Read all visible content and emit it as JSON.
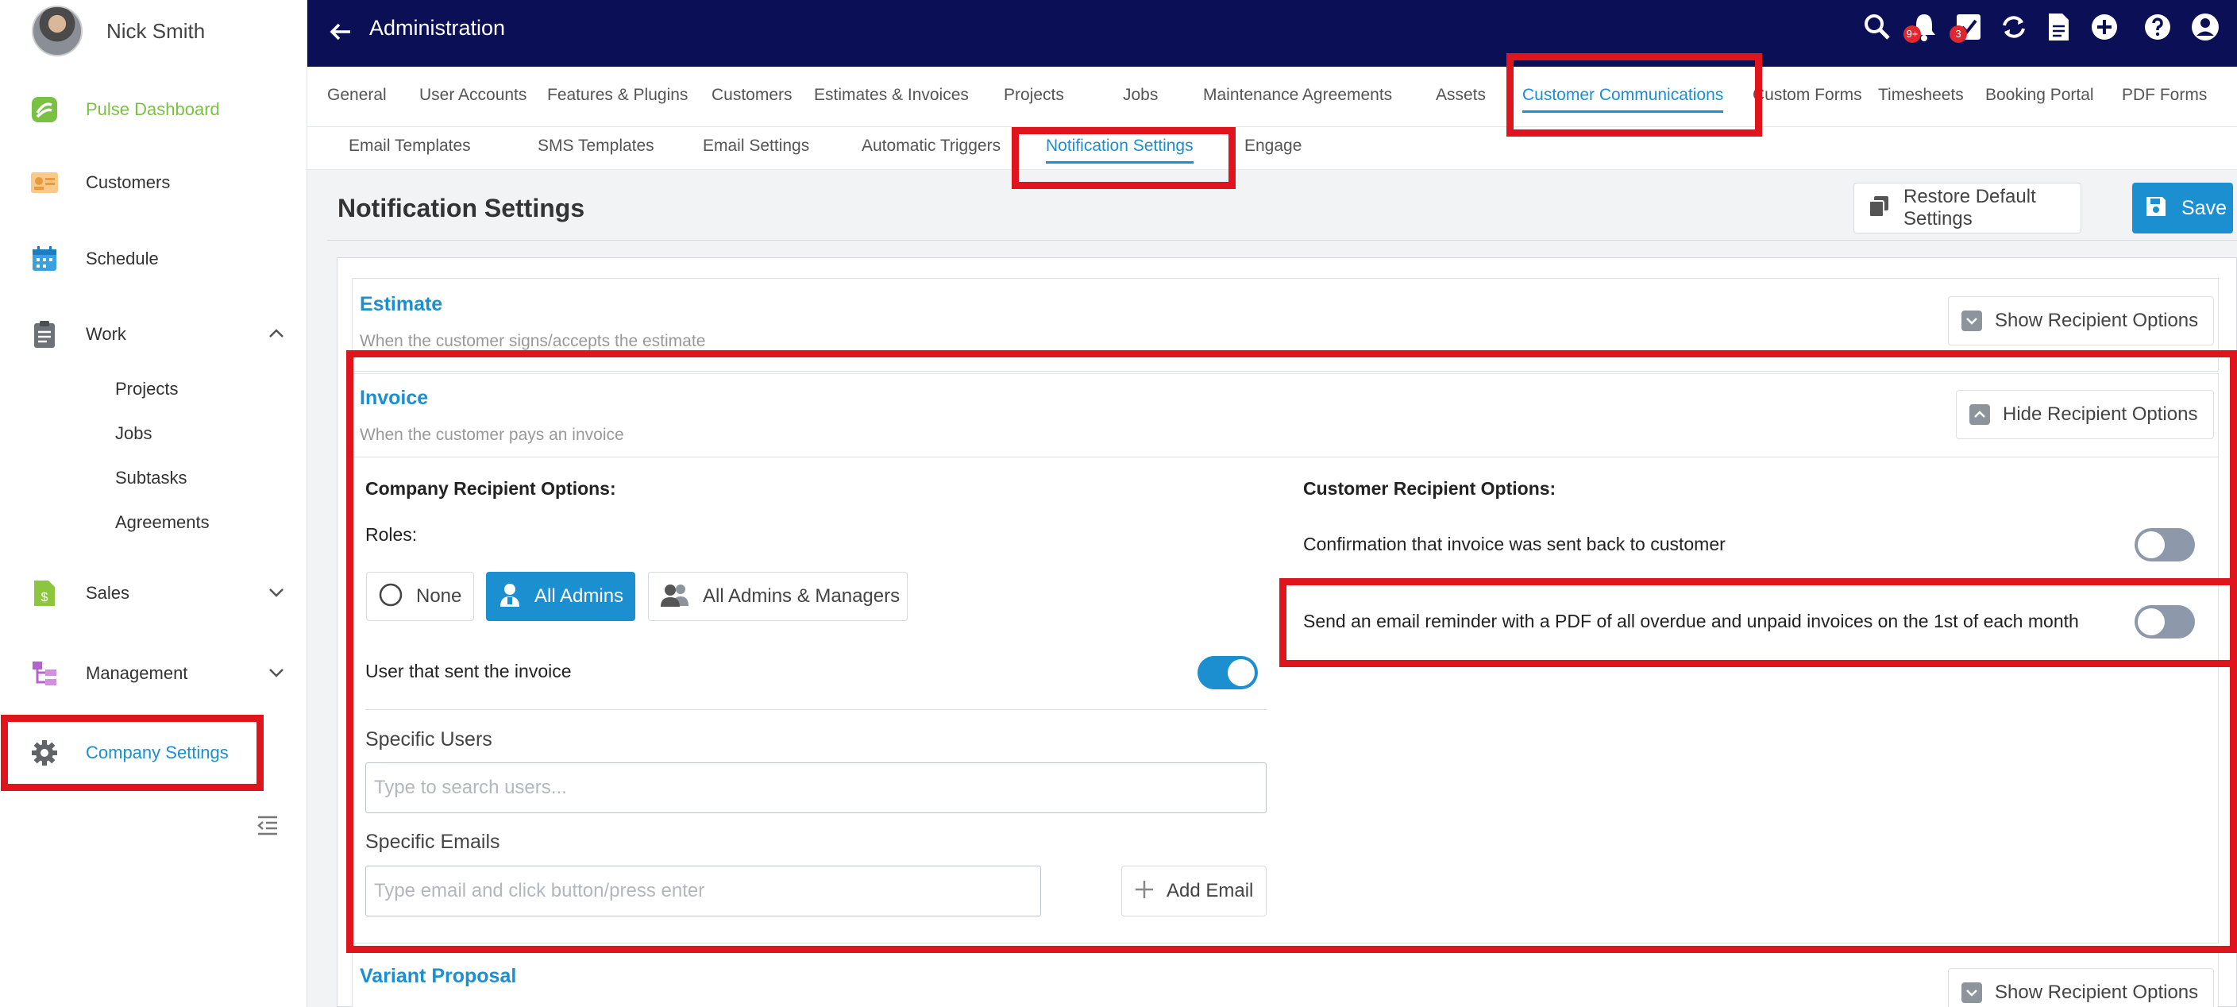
{
  "user": {
    "name": "Nick Smith"
  },
  "sidebar": {
    "items": [
      {
        "label": "Pulse Dashboard",
        "icon": "pulse-logo-icon",
        "color": "#7ac143"
      },
      {
        "label": "Customers",
        "icon": "contact-card-icon"
      },
      {
        "label": "Schedule",
        "icon": "calendar-icon"
      },
      {
        "label": "Work",
        "icon": "clipboard-icon"
      },
      {
        "label": "Sales",
        "icon": "dollar-document-icon"
      },
      {
        "label": "Management",
        "icon": "hierarchy-icon"
      },
      {
        "label": "Company Settings",
        "icon": "gear-icon",
        "active": true
      }
    ],
    "work_subitems": [
      "Projects",
      "Jobs",
      "Subtasks",
      "Agreements"
    ]
  },
  "topbar": {
    "title": "Administration",
    "notification_badge": "9+",
    "tasks_badge": "3",
    "background": "#0b0f55"
  },
  "tabs": [
    "General",
    "User Accounts",
    "Features & Plugins",
    "Customers",
    "Estimates & Invoices",
    "Projects",
    "Jobs",
    "Maintenance Agreements",
    "Assets",
    "Customer Communications",
    "Custom Forms",
    "Timesheets",
    "Booking Portal",
    "PDF Forms"
  ],
  "subtabs": [
    "Email Templates",
    "SMS Templates",
    "Email Settings",
    "Automatic Triggers",
    "Notification Settings",
    "Engage"
  ],
  "page": {
    "title": "Notification Settings",
    "restore_label": "Restore Default Settings",
    "save_label": "Save"
  },
  "estimate": {
    "title": "Estimate",
    "desc": "When the customer signs/accepts the estimate",
    "toggle_label": "Show Recipient Options"
  },
  "invoice": {
    "title": "Invoice",
    "desc": "When the customer pays an invoice",
    "toggle_label": "Hide Recipient Options",
    "company_heading": "Company Recipient Options:",
    "roles_label": "Roles:",
    "roles": [
      "None",
      "All Admins",
      "All Admins & Managers"
    ],
    "selected_role": "All Admins",
    "user_sent_label": "User that sent the invoice",
    "user_sent_on": true,
    "specific_users_label": "Specific Users",
    "specific_users_placeholder": "Type to search users...",
    "specific_emails_label": "Specific Emails",
    "specific_emails_placeholder": "Type email and click button/press enter",
    "add_email_label": "Add Email",
    "customer_heading": "Customer Recipient Options:",
    "customer_options": [
      {
        "label": "Confirmation that invoice was sent back to customer",
        "on": false
      },
      {
        "label": "Send an email reminder with a PDF of all overdue and unpaid invoices on the 1st of each month",
        "on": false
      }
    ]
  },
  "variant": {
    "title": "Variant Proposal",
    "toggle_label": "Show Recipient Options"
  },
  "colors": {
    "accent": "#1b8fd0",
    "highlight": "#e0141c"
  }
}
